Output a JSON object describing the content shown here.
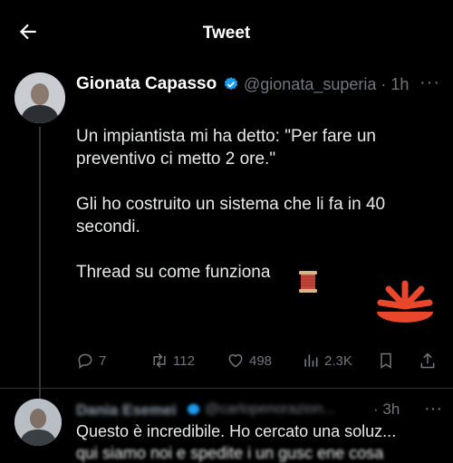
{
  "header": {
    "title": "Tweet"
  },
  "tweet": {
    "author_name": "Gionata Capasso",
    "handle": "@gionata_superia",
    "separator": "·",
    "time": "1h",
    "more_label": "···",
    "text": "Un impiantista mi ha detto: \"Per fare un preventivo ci metto 2 ore.\"\n\nGli ho costruito un sistema che li fa in 40 secondi.\n\nThread su come funziona",
    "emoji_icon": "spool-of-thread-icon",
    "logo_color": "#e8472b",
    "verified_color": "#1d9bf0"
  },
  "actions": {
    "replies": "7",
    "retweets": "112",
    "likes": "498",
    "views": "2.3K"
  },
  "reply": {
    "author_name": "Dania Esemei",
    "handle": "@carlopenorazion...",
    "separator": "·",
    "time": "3h",
    "more_label": "···",
    "text": "Questo è incredibile. Ho cercato una soluz...",
    "text_line2": "qui siamo noi e spedite i un gusc ene cosa"
  }
}
